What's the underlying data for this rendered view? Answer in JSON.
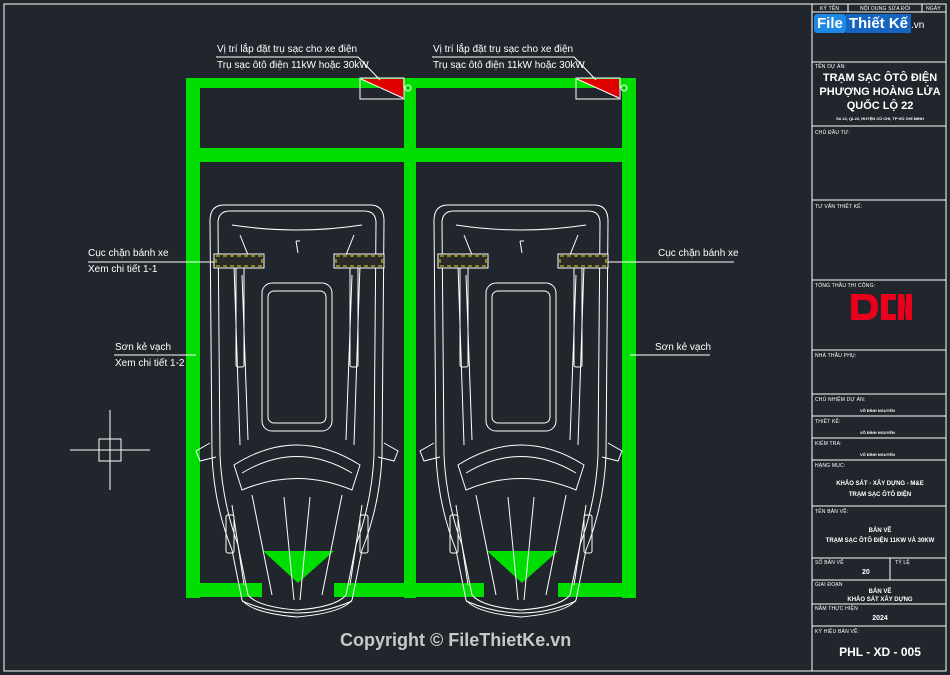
{
  "annotations": {
    "charger_location": "Vị trí lắp đặt trụ sạc cho xe điện",
    "charger_spec": "Trụ sạc ôtô điện 11kW hoặc 30kW",
    "wheel_stop": "Cục chặn bánh xe",
    "wheel_stop_detail": "Xem chi tiết 1-1",
    "line_paint": "Sơn kẻ vạch",
    "line_paint_detail": "Xem chi tiết 1-2"
  },
  "watermark": {
    "logo_file": "File",
    "logo_thiet": "Thiết Kế",
    "logo_vn": ".vn",
    "copyright": "Copyright © FileThietKe.vn"
  },
  "title_block": {
    "top_labels": [
      "KÝ TÊN",
      "NỘI DUNG SỬA ĐỔI",
      "NGÀY"
    ],
    "project_label": "TÊN DỰ ÁN:",
    "project_name": [
      "TRẠM SẠC ÔTÔ ĐIỆN",
      "PHƯỢNG HOÀNG LỬA",
      "QUỐC LỘ 22"
    ],
    "project_address": "Số 22, QL22, HUYỆN CỦ CHI, TP HỒ CHÍ MINH",
    "investor_label": "CHỦ ĐẦU TƯ:",
    "consultant_label": "TƯ VẤN THIẾT KẾ:",
    "contractor_label": "TỔNG THẦU THI CÔNG:",
    "contractor_logo": "DCN",
    "subcontractor_label": "NHÀ THẦU PHỤ:",
    "pm_label": "CHỦ NHIỆM DỰ ÁN:",
    "pm_name": "VÕ ĐÌNH NGUYÊN",
    "design_label": "THIẾT KẾ:",
    "design_name": "VÕ ĐÌNH NGUYÊN",
    "check_label": "KIỂM TRA:",
    "check_name": "VÕ ĐÌNH NGUYÊN",
    "category_label": "HẠNG MỤC:",
    "category_value": [
      "KHẢO SÁT - XÂY DỰNG - M&E",
      "TRẠM SẠC ÔTÔ ĐIỆN"
    ],
    "drawing_label": "TÊN BẢN VẼ:",
    "drawing_value": [
      "BẢN VẼ",
      "TRẠM SẠC ÔTÔ ĐIỆN 11KW VÀ 30KW"
    ],
    "sheet_no_label": "SỐ BẢN VẼ",
    "scale_label": "TỶ LỆ",
    "sheet_no_value": "20",
    "stage_label": "GIAI ĐOẠN",
    "stage_value": [
      "BẢN VẼ",
      "KHẢO SÁT XÂY DỰNG"
    ],
    "year_label": "NĂM THỰC HIỆN",
    "year_value": "2024",
    "code_label": "KÝ HIỆU BẢN VẼ:",
    "code_value": "PHL - XD - 005"
  },
  "colors": {
    "background": "#21262d",
    "parking_lines": "#00dd00",
    "charger": "#e00000",
    "car_outline": "#ffffff",
    "wheel_stop": "#e8e000",
    "brand_red": "#e8001c"
  }
}
